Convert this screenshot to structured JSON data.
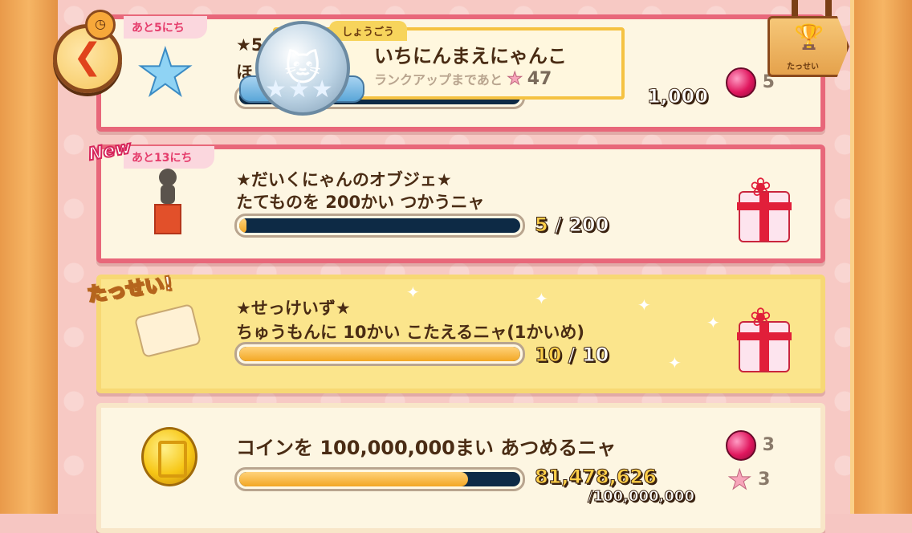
{
  "nav": {
    "back_arrow": "❮"
  },
  "rank": {
    "tab_label": "しょうごう",
    "title": "いちにんまえにゃんこ",
    "next_label": "ランクアップまであと",
    "next_value": "47",
    "medal_stars": "★★★"
  },
  "achievements_sign": {
    "label": "たっせい"
  },
  "missions": [
    {
      "days_left": "あと5にち",
      "title_line1": "★5",
      "title_line2": "ほ",
      "count": "1,000",
      "reward_gems": "5"
    },
    {
      "badge": "New",
      "days_left": "あと13にち",
      "title_line1": "★だいくにゃんのオブジェ★",
      "title_line2": "たてものを 200かい つかうニャ",
      "current": "5",
      "total": "200",
      "progress": 0.025
    },
    {
      "badge": "たっせい!",
      "title_line1": "★せっけいず★",
      "title_line2": "ちゅうもんに 10かい こたえるニャ(1かいめ)",
      "current": "10",
      "total": "10",
      "progress": 1.0
    },
    {
      "title_line1": "コインを 100,000,000まい あつめるニャ",
      "current": "81,478,626",
      "total": "/100,000,000",
      "progress": 0.815,
      "reward_gems": "3",
      "reward_stars": "3"
    }
  ]
}
